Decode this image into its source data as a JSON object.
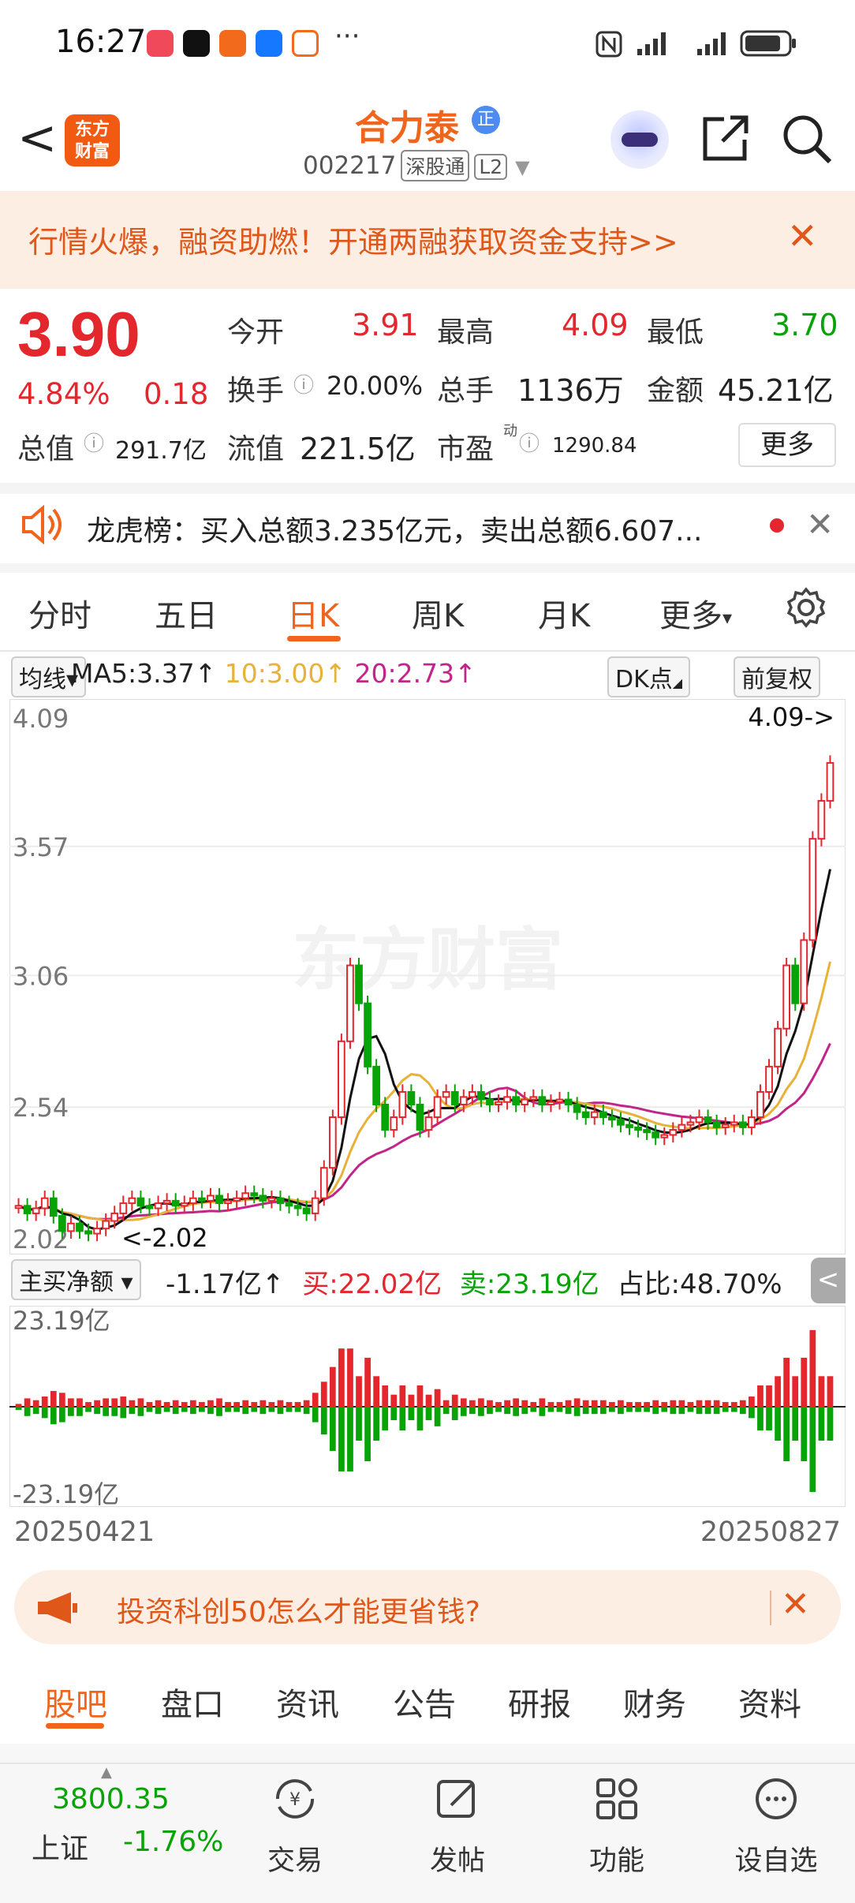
{
  "status_bar": {
    "time": "16:27",
    "more": "···",
    "app_icons": [
      "app-icon",
      "tiktok-icon",
      "app2-icon",
      "alipay-icon",
      "app3-icon"
    ],
    "right_icons": [
      "nfc-icon",
      "signal-icon",
      "signal2-icon",
      "battery-icon"
    ]
  },
  "header": {
    "back": "<",
    "logo_line1": "东方",
    "logo_line2": "财富",
    "stock_name": "合力泰",
    "badge": "正",
    "code": "002217",
    "tag1": "深股通",
    "tag2": "L2",
    "caret": "▼"
  },
  "banner": {
    "text": "行情火爆，融资助燃！开通两融获取资金支持>>",
    "close": "✕"
  },
  "quote": {
    "price": "3.90",
    "change_pct": "4.84%",
    "change": "0.18",
    "open_label": "今开",
    "open": "3.91",
    "high_label": "最高",
    "high": "4.09",
    "low_label": "最低",
    "low": "3.70",
    "turnover_label": "换手",
    "turnover": "20.00%",
    "volume_label": "总手",
    "volume": "1136万",
    "amount_label": "金额",
    "amount": "45.21亿",
    "mktcap_label": "总值",
    "mktcap": "291.7亿",
    "float_label": "流值",
    "float": "221.5亿",
    "pe_label": "市盈",
    "pe_sup": "动",
    "pe": "1290.84",
    "more_button": "更多"
  },
  "dragon_tiger": {
    "text": "龙虎榜：买入总额3.235亿元，卖出总额6.607...",
    "close": "✕"
  },
  "kline_tabs": {
    "items": [
      "分时",
      "五日",
      "日K",
      "周K",
      "月K",
      "更多"
    ],
    "active": "日K",
    "more_caret": "▾"
  },
  "ma": {
    "chip": "均线▾",
    "ma5": "MA5:3.37↑",
    "ma10": "10:3.00↑",
    "ma20": "20:2.73↑",
    "dk": "DK点",
    "dk_caret": "◢",
    "fq": "前复权"
  },
  "colors": {
    "up": "#e4262d",
    "down": "#07a307",
    "ma5": "#111111",
    "ma10": "#e8b23a",
    "ma20": "#c2248a",
    "accent": "#f0641c"
  },
  "chart_data": [
    {
      "type": "candlestick",
      "title": "",
      "y_ticks": [
        "4.09",
        "3.57",
        "3.06",
        "2.54",
        "2.02"
      ],
      "ylim": [
        2.02,
        4.09
      ],
      "annotations": {
        "high": "4.09->",
        "low": "<-2.02"
      },
      "watermark": "东方财富",
      "x_range": [
        "20250421",
        "20250827"
      ],
      "closes": [
        2.15,
        2.12,
        2.14,
        2.18,
        2.11,
        2.05,
        2.08,
        2.05,
        2.04,
        2.06,
        2.09,
        2.12,
        2.16,
        2.18,
        2.15,
        2.14,
        2.16,
        2.17,
        2.15,
        2.16,
        2.18,
        2.17,
        2.19,
        2.16,
        2.17,
        2.18,
        2.2,
        2.19,
        2.17,
        2.18,
        2.16,
        2.15,
        2.14,
        2.12,
        2.18,
        2.3,
        2.5,
        2.8,
        3.1,
        2.95,
        2.7,
        2.55,
        2.45,
        2.5,
        2.6,
        2.55,
        2.45,
        2.5,
        2.58,
        2.6,
        2.55,
        2.58,
        2.6,
        2.57,
        2.55,
        2.56,
        2.58,
        2.55,
        2.57,
        2.58,
        2.55,
        2.56,
        2.57,
        2.55,
        2.52,
        2.5,
        2.52,
        2.5,
        2.49,
        2.47,
        2.46,
        2.45,
        2.44,
        2.42,
        2.43,
        2.45,
        2.47,
        2.48,
        2.5,
        2.48,
        2.46,
        2.47,
        2.48,
        2.46,
        2.5,
        2.6,
        2.7,
        2.85,
        3.1,
        2.95,
        3.2,
        3.6,
        3.75,
        3.9
      ]
    },
    {
      "type": "bar",
      "title": "主买净额",
      "series_label": "主买净额",
      "ylim_labels": [
        "23.19亿",
        "-23.19亿"
      ],
      "x_range": [
        "20250421",
        "20250827"
      ]
    }
  ],
  "fund": {
    "chip": "主买净额 ▾",
    "net": "-1.17亿↑",
    "buy": "买:22.02亿",
    "sell": "卖:23.19亿",
    "ratio": "占比:48.70%",
    "top": "23.19亿",
    "bottom": "-23.19亿",
    "date_start": "20250421",
    "date_end": "20250827",
    "collapse": "<"
  },
  "ad": {
    "text": "投资科创50怎么才能更省钱?",
    "close": "✕"
  },
  "bottom_tabs": {
    "items": [
      "股吧",
      "盘口",
      "资讯",
      "公告",
      "研报",
      "财务",
      "资料"
    ],
    "active": "股吧"
  },
  "bottom_nav": {
    "index_value": "3800.35",
    "index_name": "上证",
    "index_pct": "-1.76%",
    "items": [
      "交易",
      "发帖",
      "功能",
      "设自选"
    ]
  }
}
